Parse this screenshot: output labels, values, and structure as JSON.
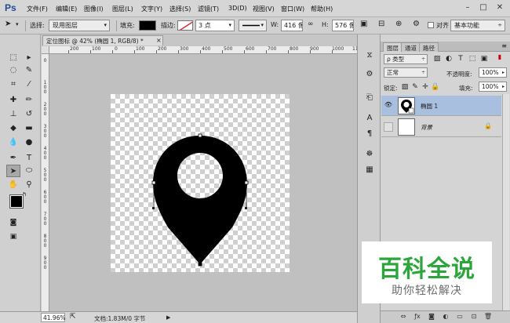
{
  "app": {
    "logo": "Ps"
  },
  "menu": [
    "文件(F)",
    "编辑(E)",
    "图像(I)",
    "图层(L)",
    "文字(Y)",
    "选择(S)",
    "滤镜(T)",
    "3D(D)",
    "视图(V)",
    "窗口(W)",
    "帮助(H)"
  ],
  "options": {
    "select_label": "选择:",
    "select_value": "现用图层",
    "fill_label": "填充:",
    "stroke_label": "描边:",
    "stroke_width": "3 点",
    "w_label": "W:",
    "w_value": "416 像",
    "h_label": "H:",
    "h_value": "576 像",
    "align_label": "对齐",
    "workspace": "基本功能"
  },
  "document": {
    "tab_title": "定位图标 @ 42% (椭圆 1, RGB/8) *",
    "tab_close": "×",
    "ruler_h": [
      "200",
      "100",
      "0",
      "100",
      "200",
      "300",
      "400",
      "500",
      "600",
      "700",
      "800",
      "900",
      "1000",
      "1100"
    ],
    "ruler_v": [
      "0",
      "1 0 0",
      "2 0 0",
      "3 0 0",
      "4 0 0",
      "5 0 0",
      "6 0 0",
      "7 0 0",
      "8 0 0",
      "9 0 0"
    ]
  },
  "status": {
    "zoom": "41.96%",
    "doc_info": "文档:1.83M/0 字节"
  },
  "panel": {
    "tabs": [
      "图层",
      "通道",
      "路径"
    ],
    "kind_label": "ρ 类型",
    "blend_mode": "正常",
    "opacity_label": "不透明度:",
    "opacity_value": "100%",
    "lock_label": "锁定:",
    "fill_label": "填充:",
    "fill_value": "100%",
    "layers": [
      {
        "name": "椭圆 1",
        "selected": true
      },
      {
        "name": "背景",
        "selected": false
      }
    ]
  },
  "watermark": {
    "title": "百科全说",
    "subtitle": "助你轻松解决"
  },
  "colors": {
    "selected_layer": "#a9bfe0",
    "watermark_green": "#2aa63a",
    "ps_blue": "#1c4e8e"
  }
}
